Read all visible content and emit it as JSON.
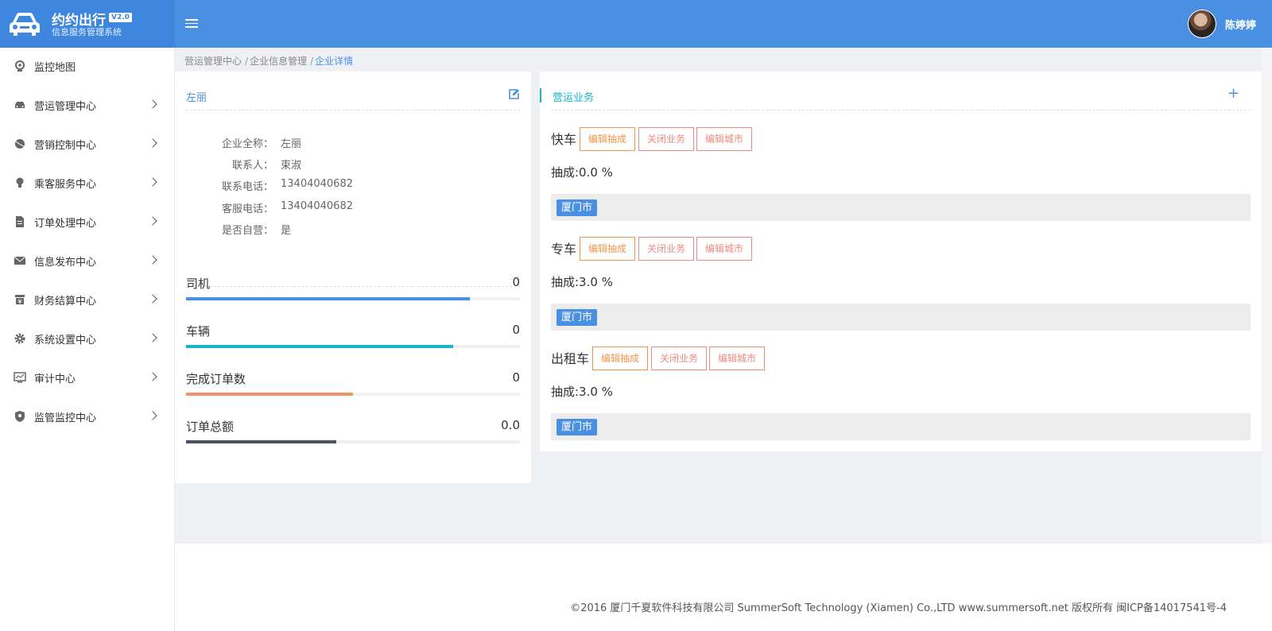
{
  "header": {
    "app_title": "约约出行",
    "version": "V2.0",
    "subtitle": "信息服务管理系统",
    "user_name": "陈婷婷"
  },
  "sidebar": {
    "items": [
      {
        "label": "监控地图",
        "icon": "map-pin-icon",
        "has_children": false
      },
      {
        "label": "营运管理中心",
        "icon": "car-icon",
        "has_children": true
      },
      {
        "label": "营销控制中心",
        "icon": "ball-icon",
        "has_children": true
      },
      {
        "label": "乘客服务中心",
        "icon": "bulb-icon",
        "has_children": true
      },
      {
        "label": "订单处理中心",
        "icon": "document-icon",
        "has_children": true
      },
      {
        "label": "信息发布中心",
        "icon": "envelope-icon",
        "has_children": true
      },
      {
        "label": "财务结算中心",
        "icon": "finance-icon",
        "has_children": true
      },
      {
        "label": "系统设置中心",
        "icon": "gear-icon",
        "has_children": true
      },
      {
        "label": "审计中心",
        "icon": "monitor-chart-icon",
        "has_children": true
      },
      {
        "label": "监管监控中心",
        "icon": "shield-pin-icon",
        "has_children": true
      }
    ]
  },
  "breadcrumb": {
    "level1": "营运管理中心",
    "level2": "企业信息管理",
    "level3": "企业详情"
  },
  "company": {
    "title": "左丽",
    "fields": [
      {
        "label": "企业全称：",
        "value": "左丽"
      },
      {
        "label": "联系人：",
        "value": "束淑"
      },
      {
        "label": "联系电话：",
        "value": "13404040682"
      },
      {
        "label": "客服电话：",
        "value": "13404040682"
      },
      {
        "label": "是否自营：",
        "value": "是"
      }
    ],
    "stats": [
      {
        "label": "司机",
        "value": "0",
        "fill": 0.85,
        "color": "#4a90e2"
      },
      {
        "label": "车辆",
        "value": "0",
        "fill": 0.8,
        "color": "#1ab4c8"
      },
      {
        "label": "完成订单数",
        "value": "0",
        "fill": 0.5,
        "color": "#f0956a"
      },
      {
        "label": "订单总额",
        "value": "0.0",
        "fill": 0.45,
        "color": "#4a5266"
      }
    ]
  },
  "business": {
    "title": "营运业务",
    "buttons": {
      "edit_rate": "编辑抽成",
      "close_business": "关闭业务",
      "edit_city": "编辑城市"
    },
    "items": [
      {
        "name": "快车",
        "rate": "抽成:0.0 %",
        "city": "厦门市"
      },
      {
        "name": "专车",
        "rate": "抽成:3.0 %",
        "city": "厦门市"
      },
      {
        "name": "出租车",
        "rate": "抽成:3.0 %",
        "city": "厦门市"
      }
    ]
  },
  "footer": {
    "copyright": "©2016 厦门千夏软件科技有限公司 SummerSoft Technology (Xiamen) Co.,LTD www.summersoft.net 版权所有 闽ICP备14017541号-4"
  },
  "colors": {
    "header_blue": "#4a90e2",
    "accent_teal": "#1ab4c8",
    "button_orange": "#f0954a",
    "button_red": "#ee8a80"
  }
}
